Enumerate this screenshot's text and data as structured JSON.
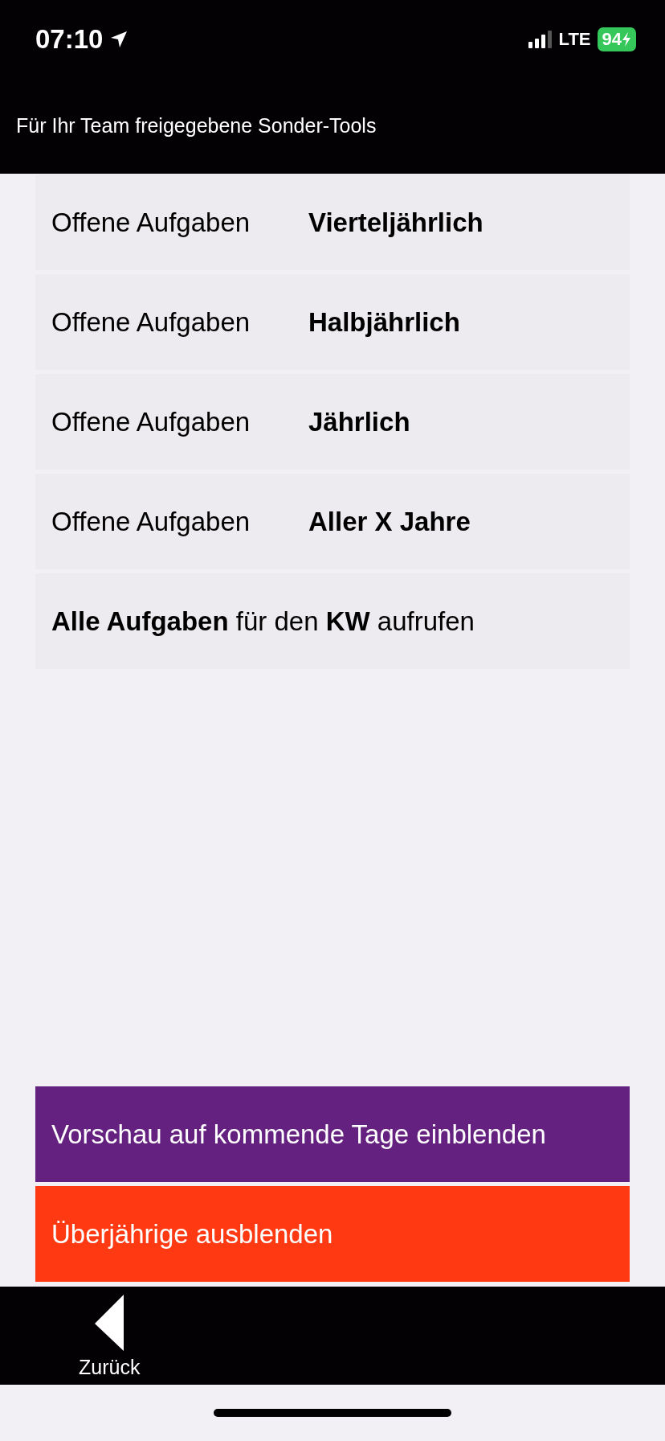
{
  "status_bar": {
    "time": "07:10",
    "network": "LTE",
    "battery": "94"
  },
  "header": {
    "title": "Für Ihr Team freigegebene Sonder-Tools"
  },
  "items": [
    {
      "kind": "pair",
      "label": "Offene Aufgaben",
      "value": "Vierteljährlich"
    },
    {
      "kind": "pair",
      "label": "Offene Aufgaben",
      "value": "Halbjährlich"
    },
    {
      "kind": "pair",
      "label": "Offene Aufgaben",
      "value": "Jährlich"
    },
    {
      "kind": "pair",
      "label": "Offene Aufgaben",
      "value": "Aller X Jahre"
    },
    {
      "kind": "sentence",
      "text": "**Alle Aufgaben** für den **KW** aufrufen"
    }
  ],
  "actions": [
    {
      "label": "Vorschau auf kommende Tage einblenden",
      "color": "#65217f"
    },
    {
      "label": "Überjährige ausblenden",
      "color": "#ff3912"
    }
  ],
  "bottom_bar": {
    "back_label": "Zurück"
  }
}
